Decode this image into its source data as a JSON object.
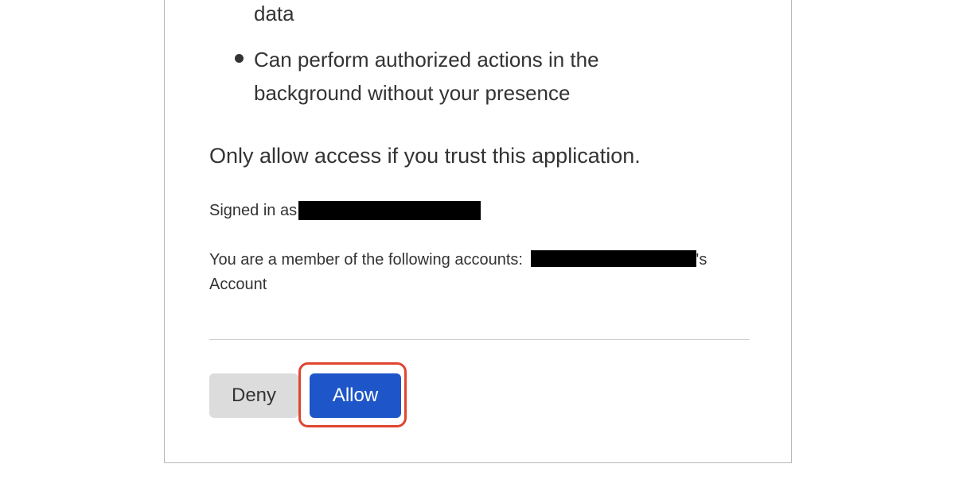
{
  "permissions": {
    "previous_fragment": "data",
    "items": [
      "Can perform authorized actions in the background without your presence"
    ]
  },
  "warning": "Only allow access if you trust this application.",
  "signed_in": {
    "label": "Signed in as"
  },
  "membership": {
    "label": "You are a member of the following accounts:",
    "account_suffix": "'s Account"
  },
  "actions": {
    "deny_label": "Deny",
    "allow_label": "Allow"
  },
  "colors": {
    "allow_button": "#1e56c9",
    "deny_button": "#dcdcdc",
    "highlight_outline": "#e0452d",
    "redaction": "#000000"
  }
}
